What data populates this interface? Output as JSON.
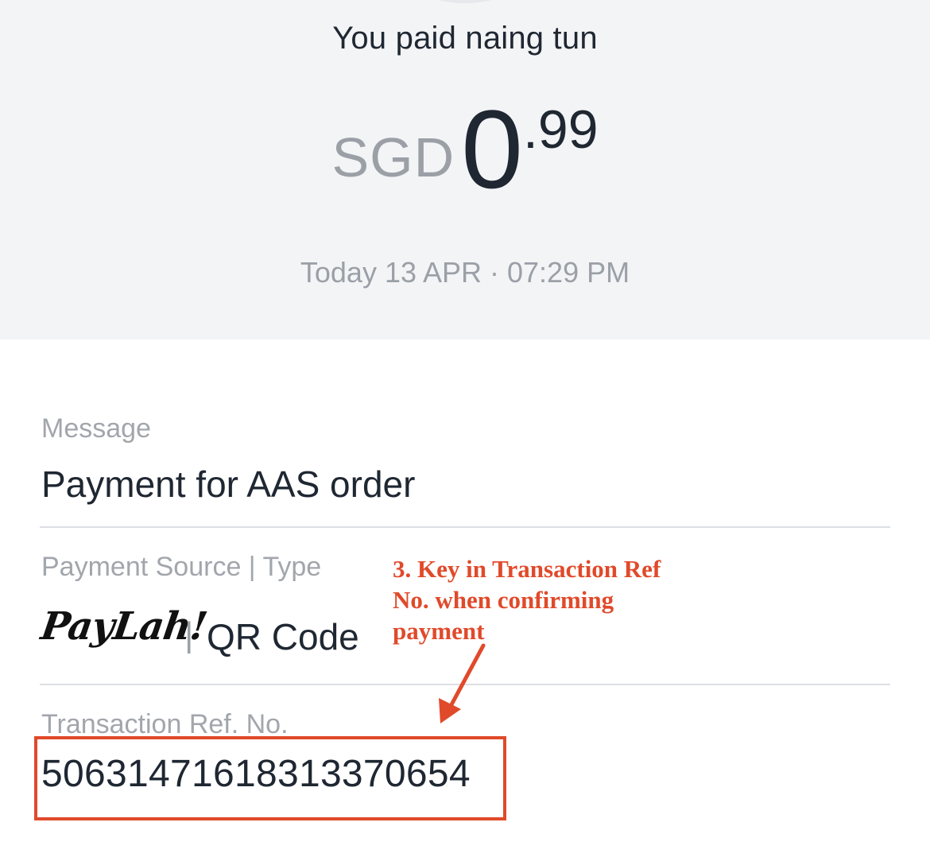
{
  "header": {
    "title": "You paid naing tun",
    "amount": {
      "currency": "SGD",
      "whole": "0",
      "fraction": ".99"
    },
    "date": "Today 13 APR · 07:29 PM"
  },
  "details": {
    "message": {
      "label": "Message",
      "value": "Payment for AAS order"
    },
    "payment_source": {
      "label": "Payment Source | Type",
      "brand": "PayLah!",
      "separator": "|",
      "type": "QR Code"
    },
    "transaction_ref": {
      "label": "Transaction Ref. No.",
      "value": "50631471618313370654"
    }
  },
  "annotation": {
    "lines": [
      "3. Key in Transaction Ref",
      "No. when confirming",
      "payment"
    ],
    "color": "#e04a2a"
  },
  "colors": {
    "header_bg": "#f3f4f6",
    "text_primary": "#1f2732",
    "text_secondary": "#9ba0a7",
    "divider": "#dcdfe3"
  }
}
